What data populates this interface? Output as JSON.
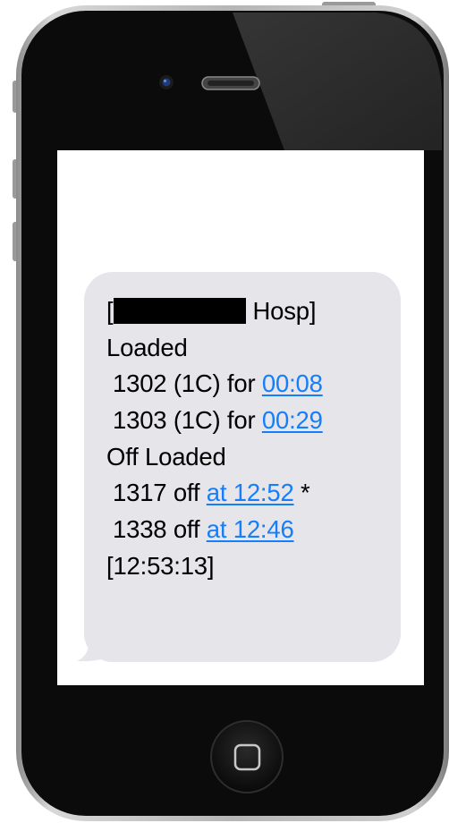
{
  "message": {
    "header": {
      "open_bracket": "[",
      "hospital_suffix": "Hosp]"
    },
    "loaded_heading": "Loaded",
    "loaded_items": [
      {
        "unit": "1302 (1C) for ",
        "time": "00:08"
      },
      {
        "unit": "1303 (1C) for ",
        "time": "00:29"
      }
    ],
    "off_loaded_heading": "Off Loaded",
    "off_loaded_items": [
      {
        "unit": "1317 off ",
        "time": "at 12:52",
        "suffix": " *"
      },
      {
        "unit": "1338 off ",
        "time": "at 12:46",
        "suffix": ""
      }
    ],
    "timestamp": "[12:53:13]"
  },
  "colors": {
    "bubble": "#e5e5ea",
    "link": "#157efb",
    "phone_body": "#0d0d0d",
    "screen": "#ffffff"
  },
  "icons": {
    "camera": "front-camera-icon",
    "speaker": "earpiece-speaker-icon",
    "home": "home-button-icon"
  }
}
